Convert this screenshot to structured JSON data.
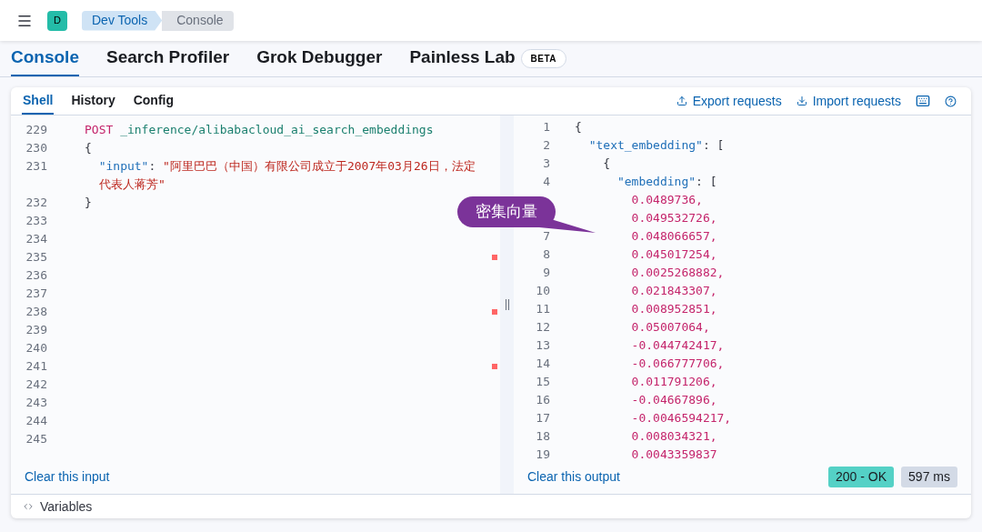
{
  "top_bar": {
    "avatar": "D",
    "breadcrumbs": [
      {
        "label": "Dev Tools",
        "selected": false
      },
      {
        "label": "Console",
        "selected": true
      }
    ]
  },
  "app_tabs": [
    {
      "label": "Console",
      "selected": true
    },
    {
      "label": "Search Profiler",
      "selected": false
    },
    {
      "label": "Grok Debugger",
      "selected": false
    },
    {
      "label": "Painless Lab",
      "selected": false,
      "badge": "BETA"
    }
  ],
  "panel": {
    "tabs": [
      {
        "label": "Shell",
        "selected": true
      },
      {
        "label": "History",
        "selected": false
      },
      {
        "label": "Config",
        "selected": false
      }
    ],
    "actions": [
      "Export requests",
      "Import requests"
    ]
  },
  "input_editor": {
    "lines": [
      {
        "number": "229",
        "marked": false,
        "tokens": [
          {
            "kind": "method",
            "text": "POST"
          },
          {
            "kind": "path",
            "text": " _inference/alibabacloud_ai_search_embeddings"
          }
        ]
      },
      {
        "number": "230",
        "marked": false,
        "tokens": [
          {
            "kind": "punct",
            "text": "{"
          }
        ]
      },
      {
        "number": "231",
        "marked": false,
        "tokens": [
          {
            "kind": "key",
            "text": "  \"input\""
          },
          {
            "kind": "punct",
            "text": ": "
          },
          {
            "kind": "string",
            "text": "\"阿里巴巴（中国）有限公司成立于2007年03月26日，法定代表人蒋芳\""
          }
        ]
      },
      {
        "number": "232",
        "marked": false,
        "tokens": [
          {
            "kind": "punct",
            "text": "}"
          }
        ]
      },
      {
        "number": "233",
        "marked": false
      },
      {
        "number": "234",
        "marked": false
      },
      {
        "number": "235",
        "marked": true
      },
      {
        "number": "236",
        "marked": false
      },
      {
        "number": "237",
        "marked": false
      },
      {
        "number": "238",
        "marked": true
      },
      {
        "number": "239",
        "marked": false
      },
      {
        "number": "240",
        "marked": false
      },
      {
        "number": "241",
        "marked": true
      },
      {
        "number": "242",
        "marked": false
      },
      {
        "number": "243",
        "marked": false
      },
      {
        "number": "244",
        "marked": false
      },
      {
        "number": "245",
        "marked": false
      }
    ],
    "clear_label": "Clear this input"
  },
  "output_editor": {
    "lines": [
      {
        "number": "1",
        "tokens": [
          {
            "kind": "punct",
            "text": "{"
          }
        ]
      },
      {
        "number": "2",
        "tokens": [
          {
            "kind": "key",
            "text": "  \"text_embedding\""
          },
          {
            "kind": "punct",
            "text": ": ["
          }
        ]
      },
      {
        "number": "3",
        "tokens": [
          {
            "kind": "punct",
            "text": "    {"
          }
        ]
      },
      {
        "number": "4",
        "tokens": [
          {
            "kind": "key",
            "text": "      \"embedding\""
          },
          {
            "kind": "punct",
            "text": ": ["
          }
        ]
      },
      {
        "tokens": [
          {
            "kind": "number",
            "text": "        0.0489736,"
          }
        ]
      },
      {
        "tokens": [
          {
            "kind": "number",
            "text": "        0.049532726,"
          }
        ]
      },
      {
        "number": "7",
        "tokens": [
          {
            "kind": "number",
            "text": "        0.048066657,"
          }
        ]
      },
      {
        "number": "8",
        "tokens": [
          {
            "kind": "number",
            "text": "        0.045017254,"
          }
        ]
      },
      {
        "number": "9",
        "tokens": [
          {
            "kind": "number",
            "text": "        0.0025268882,"
          }
        ]
      },
      {
        "number": "10",
        "tokens": [
          {
            "kind": "number",
            "text": "        0.021843307,"
          }
        ]
      },
      {
        "number": "11",
        "tokens": [
          {
            "kind": "number",
            "text": "        0.008952851,"
          }
        ]
      },
      {
        "number": "12",
        "tokens": [
          {
            "kind": "number",
            "text": "        0.05007064,"
          }
        ]
      },
      {
        "number": "13",
        "tokens": [
          {
            "kind": "number",
            "text": "        -0.044742417,"
          }
        ]
      },
      {
        "number": "14",
        "tokens": [
          {
            "kind": "number",
            "text": "        -0.066777706,"
          }
        ]
      },
      {
        "number": "15",
        "tokens": [
          {
            "kind": "number",
            "text": "        0.011791206,"
          }
        ]
      },
      {
        "number": "16",
        "tokens": [
          {
            "kind": "number",
            "text": "        -0.04667896,"
          }
        ]
      },
      {
        "number": "17",
        "tokens": [
          {
            "kind": "number",
            "text": "        -0.0046594217,"
          }
        ]
      },
      {
        "number": "18",
        "tokens": [
          {
            "kind": "number",
            "text": "        0.008034321,"
          }
        ]
      },
      {
        "number": "19",
        "tokens": [
          {
            "kind": "number",
            "text": "        0.0043359837"
          }
        ]
      }
    ],
    "clear_label": "Clear this output",
    "status": {
      "label": "200 - OK",
      "color": "#54d1c6"
    },
    "duration": "597 ms"
  },
  "callout": "密集向量",
  "variables_label": "Variables"
}
